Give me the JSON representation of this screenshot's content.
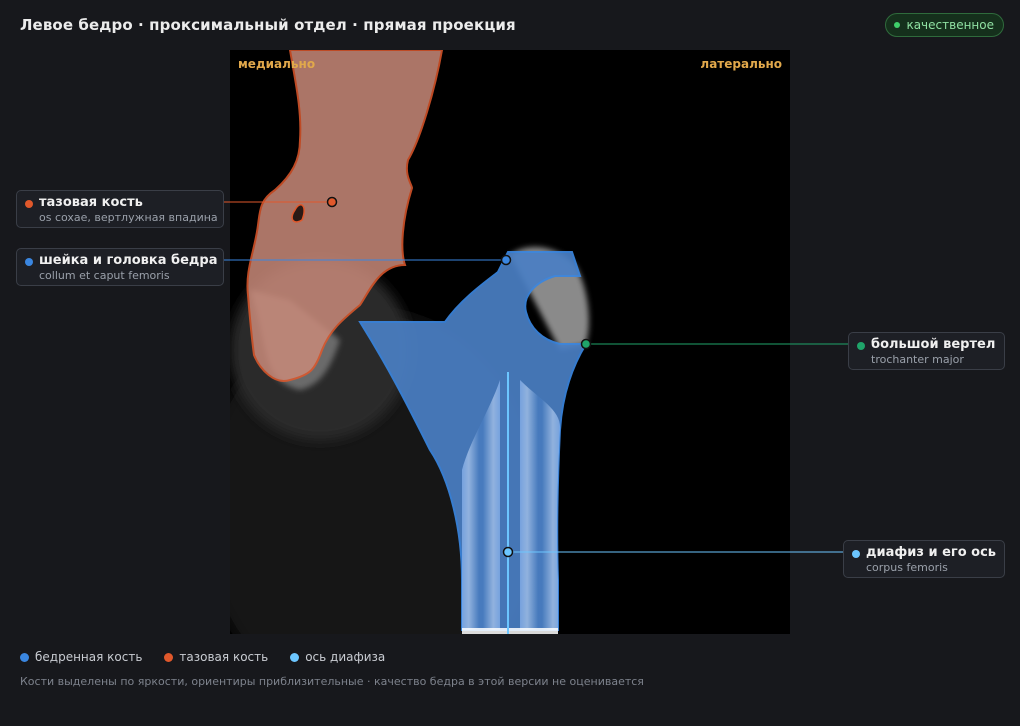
{
  "header": {
    "title": "Левое бедро · проксимальный отдел · прямая проекция",
    "badge": "качественное"
  },
  "viewer": {
    "orient_left": "медиально",
    "orient_right": "латерально"
  },
  "callouts": [
    {
      "name": "тазовая кость",
      "sub": "os coxae, вертлужная впадина",
      "color": "#e0582b"
    },
    {
      "name": "шейка и головка бедра",
      "sub": "collum et caput femoris",
      "color": "#3a86e0"
    },
    {
      "name": "большой вертел",
      "sub": "trochanter major",
      "color": "#1fa46a"
    },
    {
      "name": "диафиз и его ось",
      "sub": "corpus femoris",
      "color": "#6cc6ff"
    }
  ],
  "legend": [
    {
      "label": "бедренная кость",
      "color": "#3a86e0"
    },
    {
      "label": "тазовая кость",
      "color": "#e0582b"
    },
    {
      "label": "ось диафиза",
      "color": "#6cc6ff"
    }
  ],
  "footnote": "Кости выделены по яркости, ориентиры приблизительные · качество бедра в этой версии не оценивается"
}
